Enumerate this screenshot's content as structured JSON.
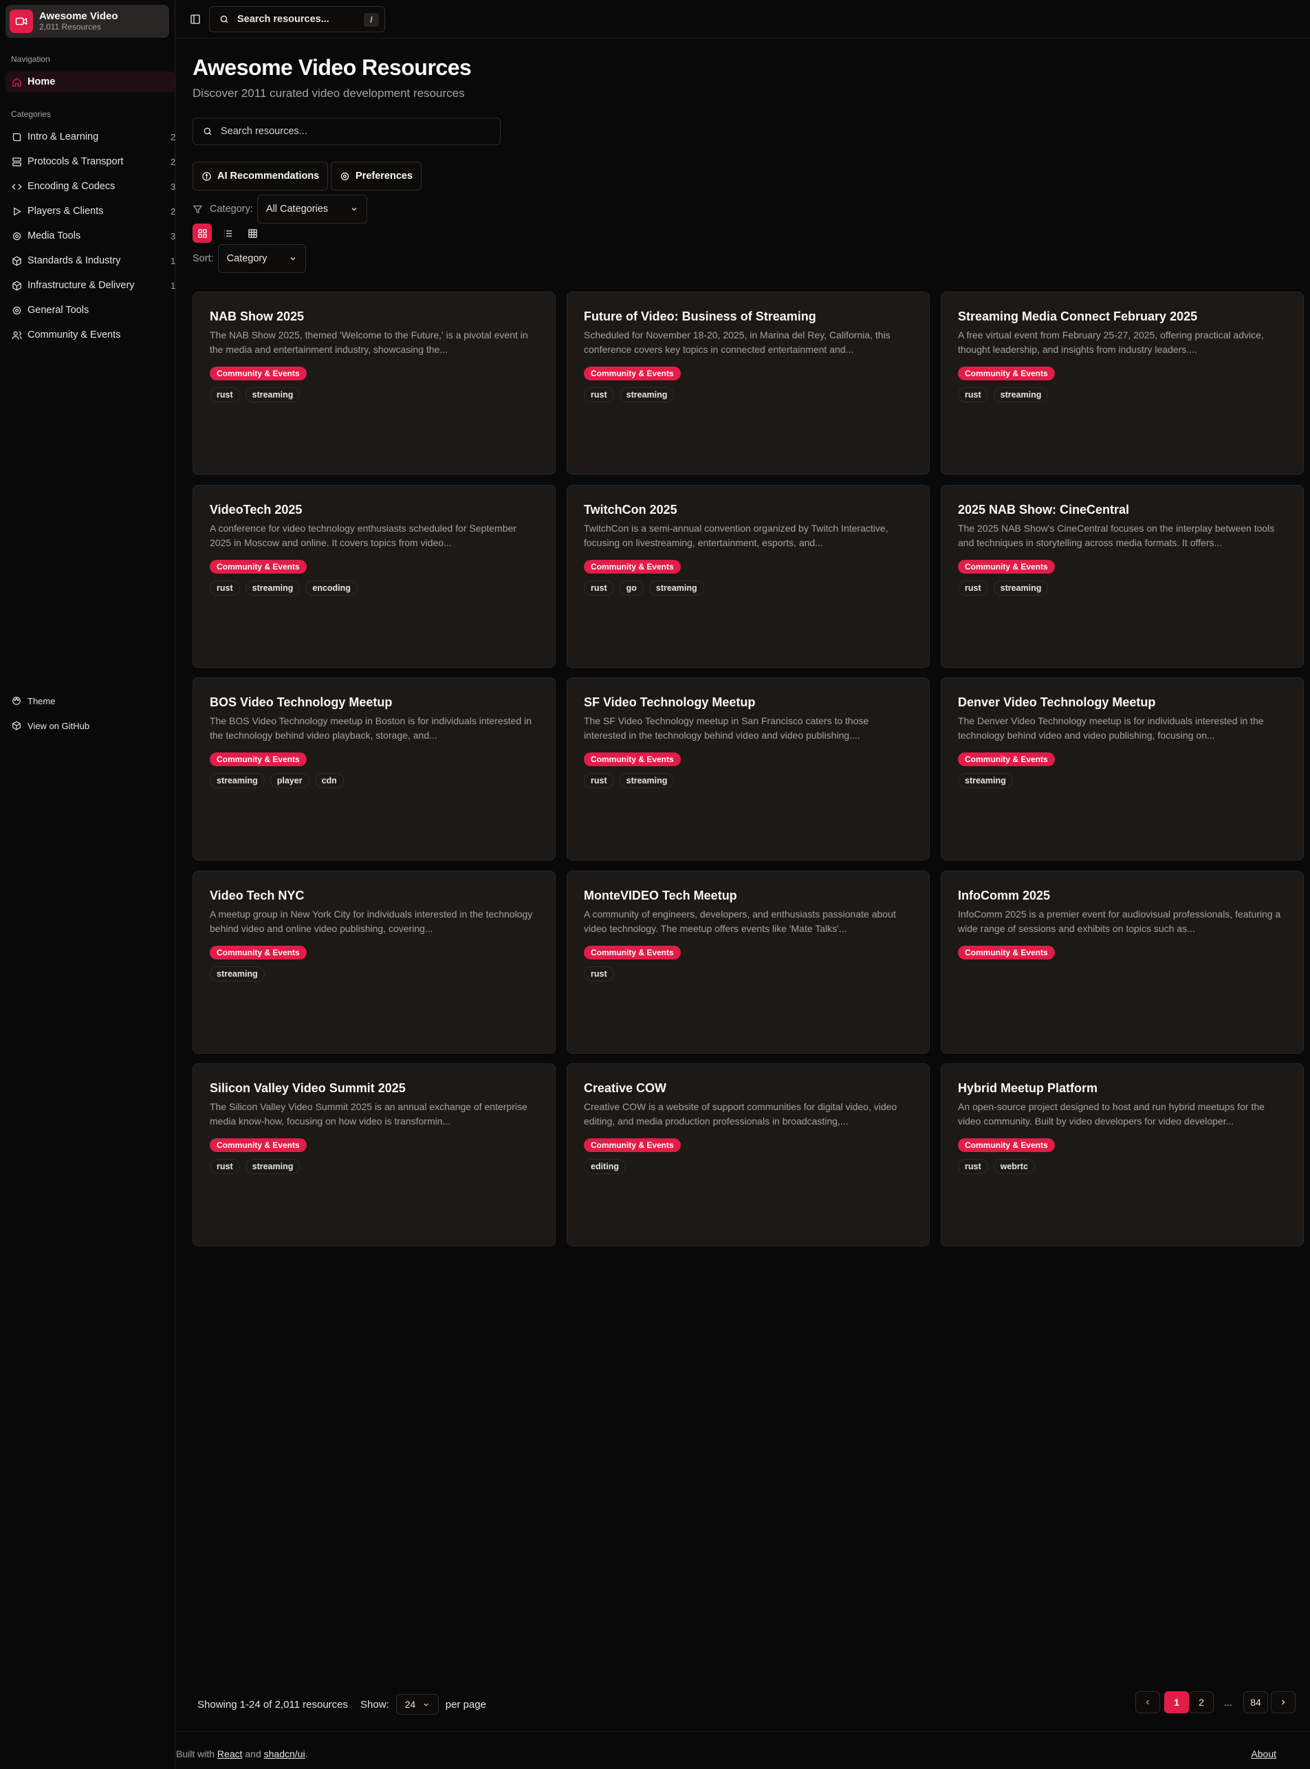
{
  "brand": {
    "title": "Awesome Video",
    "subtitle": "2,011 Resources"
  },
  "sidebar": {
    "nav_heading": "Navigation",
    "home": "Home",
    "categories_heading": "Categories",
    "categories": [
      {
        "label": "Intro & Learning",
        "count": "2"
      },
      {
        "label": "Protocols & Transport",
        "count": "2"
      },
      {
        "label": "Encoding & Codecs",
        "count": "3"
      },
      {
        "label": "Players & Clients",
        "count": "2"
      },
      {
        "label": "Media Tools",
        "count": "3"
      },
      {
        "label": "Standards & Industry",
        "count": "1"
      },
      {
        "label": "Infrastructure & Delivery",
        "count": "1"
      },
      {
        "label": "General Tools",
        "count": ""
      },
      {
        "label": "Community & Events",
        "count": ""
      }
    ],
    "theme": "Theme",
    "github": "View on GitHub"
  },
  "topbar": {
    "search_placeholder": "Search resources...",
    "shortcut": "/"
  },
  "main": {
    "title": "Awesome Video Resources",
    "subtitle": "Discover 2011 curated video development resources",
    "search_placeholder": "Search resources...",
    "ai_button": "AI Recommendations",
    "prefs_button": "Preferences",
    "category_label": "Category:",
    "category_value": "All Categories",
    "sort_label": "Sort:",
    "sort_value": "Category"
  },
  "cards": [
    {
      "title": "NAB Show 2025",
      "desc": "The NAB Show 2025, themed 'Welcome to the Future,' is a pivotal event in the media and entertainment industry, showcasing the...",
      "badge": "Community & Events",
      "tags": [
        "rust",
        "streaming"
      ]
    },
    {
      "title": "Future of Video: Business of Streaming",
      "desc": "Scheduled for November 18-20, 2025, in Marina del Rey, California, this conference covers key topics in connected entertainment and...",
      "badge": "Community & Events",
      "tags": [
        "rust",
        "streaming"
      ]
    },
    {
      "title": "Streaming Media Connect February 2025",
      "desc": "A free virtual event from February 25-27, 2025, offering practical advice, thought leadership, and insights from industry leaders....",
      "badge": "Community & Events",
      "tags": [
        "rust",
        "streaming"
      ]
    },
    {
      "title": "VideoTech 2025",
      "desc": "A conference for video technology enthusiasts scheduled for September 2025 in Moscow and online. It covers topics from video...",
      "badge": "Community & Events",
      "tags": [
        "rust",
        "streaming",
        "encoding"
      ]
    },
    {
      "title": "TwitchCon 2025",
      "desc": "TwitchCon is a semi-annual convention organized by Twitch Interactive, focusing on livestreaming, entertainment, esports, and...",
      "badge": "Community & Events",
      "tags": [
        "rust",
        "go",
        "streaming"
      ]
    },
    {
      "title": "2025 NAB Show: CineCentral",
      "desc": "The 2025 NAB Show's CineCentral focuses on the interplay between tools and techniques in storytelling across media formats. It offers...",
      "badge": "Community & Events",
      "tags": [
        "rust",
        "streaming"
      ]
    },
    {
      "title": "BOS Video Technology Meetup",
      "desc": "The BOS Video Technology meetup in Boston is for individuals interested in the technology behind video playback, storage, and...",
      "badge": "Community & Events",
      "tags": [
        "streaming",
        "player",
        "cdn"
      ]
    },
    {
      "title": "SF Video Technology Meetup",
      "desc": "The SF Video Technology meetup in San Francisco caters to those interested in the technology behind video and video publishing....",
      "badge": "Community & Events",
      "tags": [
        "rust",
        "streaming"
      ]
    },
    {
      "title": "Denver Video Technology Meetup",
      "desc": "The Denver Video Technology meetup is for individuals interested in the technology behind video and video publishing, focusing on...",
      "badge": "Community & Events",
      "tags": [
        "streaming"
      ]
    },
    {
      "title": "Video Tech NYC",
      "desc": "A meetup group in New York City for individuals interested in the technology behind video and online video publishing, covering...",
      "badge": "Community & Events",
      "tags": [
        "streaming"
      ]
    },
    {
      "title": "MonteVIDEO Tech Meetup",
      "desc": "A community of engineers, developers, and enthusiasts passionate about video technology. The meetup offers events like 'Mate Talks'...",
      "badge": "Community & Events",
      "tags": [
        "rust"
      ]
    },
    {
      "title": "InfoComm 2025",
      "desc": "InfoComm 2025 is a premier event for audiovisual professionals, featuring a wide range of sessions and exhibits on topics such as...",
      "badge": "Community & Events",
      "tags": []
    },
    {
      "title": "Silicon Valley Video Summit 2025",
      "desc": "The Silicon Valley Video Summit 2025 is an annual exchange of enterprise media know-how, focusing on how video is transformin...",
      "badge": "Community & Events",
      "tags": [
        "rust",
        "streaming"
      ]
    },
    {
      "title": "Creative COW",
      "desc": "Creative COW is a website of support communities for digital video, video editing, and media production professionals in broadcasting,...",
      "badge": "Community & Events",
      "tags": [
        "editing"
      ]
    },
    {
      "title": "Hybrid Meetup Platform",
      "desc": "An open-source project designed to host and run hybrid meetups for the video community. Built by video developers for video developer...",
      "badge": "Community & Events",
      "tags": [
        "rust",
        "webrtc"
      ]
    }
  ],
  "pagination": {
    "showing": "Showing 1-24 of 2,011 resources",
    "show_label": "Show:",
    "per_page_value": "24",
    "per_page_label": "per page",
    "pages": [
      "1",
      "2",
      "...",
      "84"
    ]
  },
  "footer": {
    "built_with": "Built with",
    "react": "React",
    "and": "and",
    "shadcn": "shadcn/ui",
    "period": ".",
    "about": "About"
  },
  "colors": {
    "accent": "#e11d48",
    "background": "#0a0909",
    "card": "#1c1917"
  }
}
